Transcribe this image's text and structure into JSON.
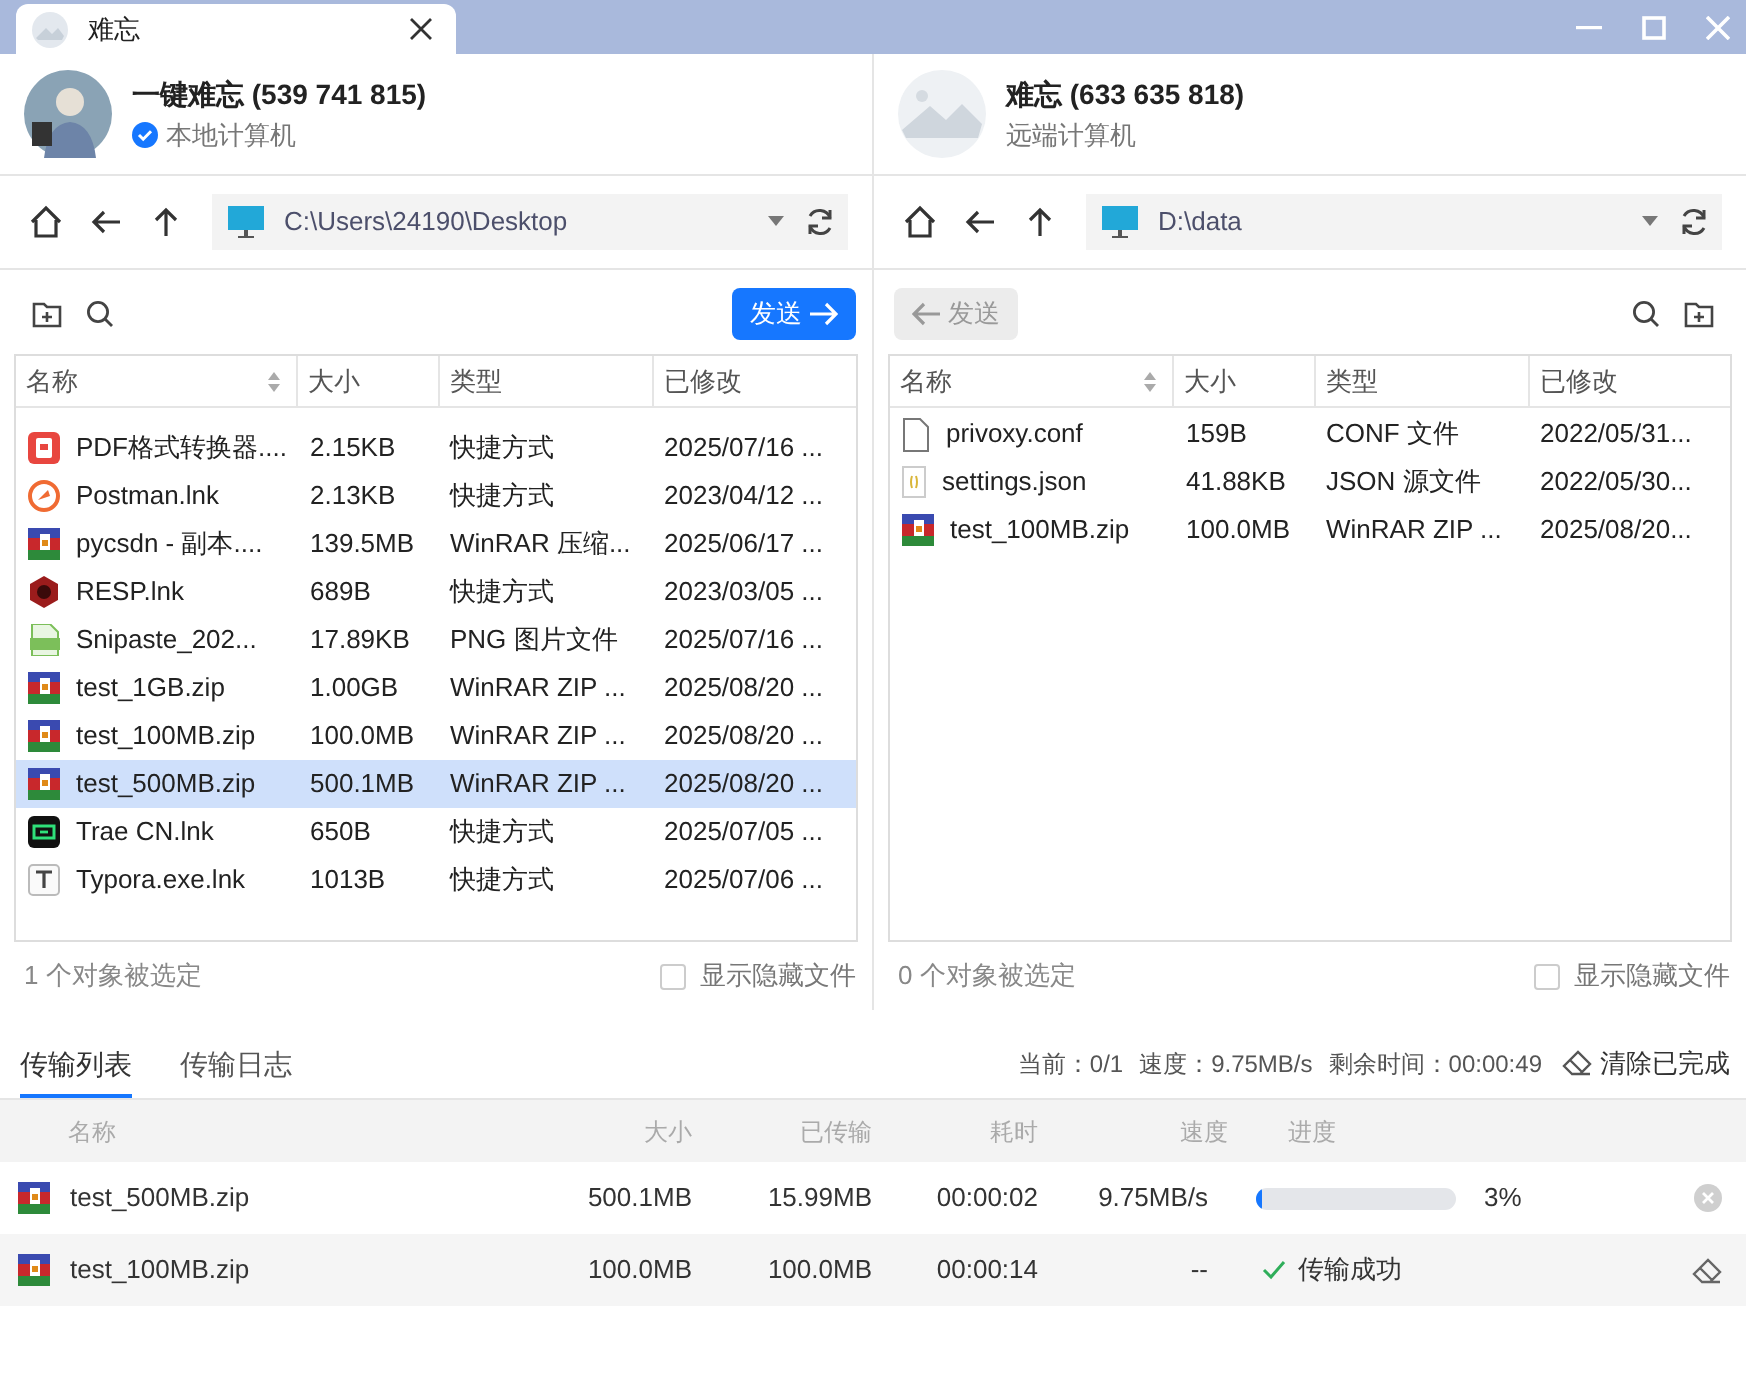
{
  "window": {
    "tab_title": "难忘"
  },
  "panels": [
    {
      "user": {
        "name": "一键难忘 (539 741 815)",
        "role": "本地计算机",
        "verified": true,
        "kind": "person"
      },
      "path": "C:\\Users\\24190\\Desktop",
      "send": {
        "label": "发送",
        "disabled": false
      },
      "columns": [
        "名称",
        "大小",
        "类型",
        "已修改"
      ],
      "rows": [
        {
          "kind": "pdf",
          "name": "PDF格式转换器....",
          "size": "2.15KB",
          "type": "快捷方式",
          "modified": "2025/07/16 ...",
          "selected": false
        },
        {
          "kind": "postman",
          "name": "Postman.lnk",
          "size": "2.13KB",
          "type": "快捷方式",
          "modified": "2023/04/12 ...",
          "selected": false
        },
        {
          "kind": "rar",
          "name": "pycsdn - 副本....",
          "size": "139.5MB",
          "type": "WinRAR 压缩...",
          "modified": "2025/06/17 ...",
          "selected": false
        },
        {
          "kind": "resp",
          "name": "RESP.lnk",
          "size": "689B",
          "type": "快捷方式",
          "modified": "2023/03/05 ...",
          "selected": false
        },
        {
          "kind": "png",
          "name": "Snipaste_202...",
          "size": "17.89KB",
          "type": "PNG 图片文件",
          "modified": "2025/07/16 ...",
          "selected": false
        },
        {
          "kind": "rar",
          "name": "test_1GB.zip",
          "size": "1.00GB",
          "type": "WinRAR ZIP ...",
          "modified": "2025/08/20 ...",
          "selected": false
        },
        {
          "kind": "rar",
          "name": "test_100MB.zip",
          "size": "100.0MB",
          "type": "WinRAR ZIP ...",
          "modified": "2025/08/20 ...",
          "selected": false
        },
        {
          "kind": "rar",
          "name": "test_500MB.zip",
          "size": "500.1MB",
          "type": "WinRAR ZIP ...",
          "modified": "2025/08/20 ...",
          "selected": true
        },
        {
          "kind": "trae",
          "name": "Trae CN.lnk",
          "size": "650B",
          "type": "快捷方式",
          "modified": "2025/07/05 ...",
          "selected": false
        },
        {
          "kind": "typora",
          "name": "Typora.exe.lnk",
          "size": "1013B",
          "type": "快捷方式",
          "modified": "2025/07/06 ...",
          "selected": false
        }
      ],
      "selection": "1 个对象被选定",
      "show_hidden": {
        "label": "显示隐藏文件",
        "checked": false
      }
    },
    {
      "user": {
        "name": "难忘 (633 635 818)",
        "role": "远端计算机",
        "verified": false,
        "kind": "placeholder"
      },
      "path": "D:\\data",
      "send": {
        "label": "发送",
        "disabled": true
      },
      "columns": [
        "名称",
        "大小",
        "类型",
        "已修改"
      ],
      "rows": [
        {
          "kind": "file",
          "name": "privoxy.conf",
          "size": "159B",
          "type": "CONF 文件",
          "modified": "2022/05/31...",
          "selected": false
        },
        {
          "kind": "json",
          "name": "settings.json",
          "size": "41.88KB",
          "type": "JSON 源文件",
          "modified": "2022/05/30...",
          "selected": false
        },
        {
          "kind": "rar",
          "name": "test_100MB.zip",
          "size": "100.0MB",
          "type": "WinRAR ZIP ...",
          "modified": "2025/08/20...",
          "selected": false
        }
      ],
      "selection": "0 个对象被选定",
      "show_hidden": {
        "label": "显示隐藏文件",
        "checked": false
      }
    }
  ],
  "transfer": {
    "tabs": [
      {
        "label": "传输列表",
        "selected": true
      },
      {
        "label": "传输日志",
        "selected": false
      }
    ],
    "stats": [
      "当前：0/1",
      "速度：9.75MB/s",
      "剩余时间：00:00:49"
    ],
    "clear_label": "清除已完成",
    "columns": [
      "名称",
      "大小",
      "已传输",
      "耗时",
      "速度",
      "进度"
    ],
    "rows": [
      {
        "kind": "progress",
        "name": "test_500MB.zip",
        "size": "500.1MB",
        "transferred": "15.99MB",
        "elapsed": "00:00:02",
        "speed": "9.75MB/s",
        "level": 0.03,
        "percent": "3%"
      },
      {
        "kind": "done",
        "name": "test_100MB.zip",
        "size": "100.0MB",
        "transferred": "100.0MB",
        "elapsed": "00:00:14",
        "speed": "--",
        "status": "传输成功"
      }
    ]
  }
}
